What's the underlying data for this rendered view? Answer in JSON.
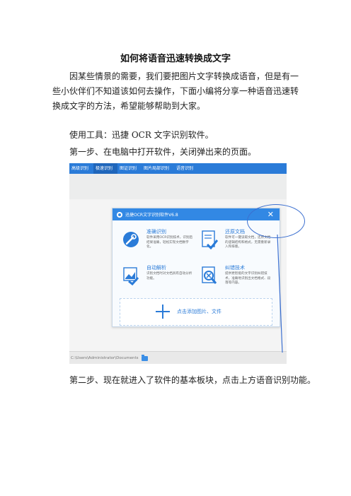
{
  "doc": {
    "title": "如何将语音迅速转换成文字",
    "intro": "因某些情景的需要，我们要把图片文字转换成语音，但是有一些小伙伴们不知道该如何去操作，下面小编将分享一种语音迅速转换成文字的方法，希望能够帮助到大家。",
    "tool": "使用工具：迅捷 OCR 文字识别软件。",
    "step1": "第一步、在电脑中打开软件，关闭弹出来的页面。",
    "step2": "第二步、现在就进入了软件的基本板块，点击上方语音识别功能。"
  },
  "screenshot": {
    "tabs": [
      "高级识别",
      "极速识别",
      "图证识别",
      "图片局部识别",
      "语音识别"
    ],
    "dialog_title": "迅捷OCR文字识别软件V6.8",
    "close_symbol": "✕",
    "features": [
      {
        "title": "准确识别",
        "desc": "软件采用OCR识别技术，识别后结果准确，轻松实现文档数字化。"
      },
      {
        "title": "还原文档",
        "desc": "软件可一键读取文档，还原文档的逻辑结构和格式，无需重新录入和排版。"
      },
      {
        "title": "自动解析",
        "desc": "识别文档时对文档具有自动分析功能。"
      },
      {
        "title": "纠错技术",
        "desc": "提供更智能的文字识别纠错技术，准确地识别出文档格式、段落等内容。"
      }
    ],
    "add_label": "点击添加图片、文件",
    "status_path": "C:\\Users\\Administrator\\Documents"
  }
}
